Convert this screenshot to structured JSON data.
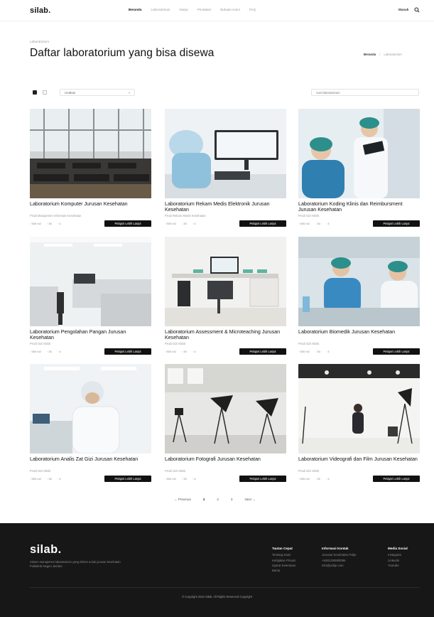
{
  "header": {
    "logo": "silab.",
    "nav": [
      "Beranda",
      "Laboratorium",
      "Sarpa",
      "Peralatan",
      "Bukaan Kami",
      "FAQ"
    ],
    "active_nav": 0,
    "lang": "Masuk"
  },
  "page": {
    "eyebrow": "Laboratorium",
    "title": "Daftar laboratorium yang bisa disewa",
    "breadcrumb": {
      "home": "Beranda",
      "sep": "/",
      "current": "Laboratorium"
    }
  },
  "toolbar": {
    "sort_label": "Urutkan",
    "search_placeholder": "Cari laboratorium"
  },
  "cards": [
    {
      "title": "Laboratorium Komputer Jurusan Kesehatan",
      "subtitle": "Prodi Manajemen Informasi Kesehatan",
      "meta": [
        "500 m2",
        "30",
        "4"
      ],
      "button": "Pelajari Lebih Lanjut"
    },
    {
      "title": "Laboratorium Rekam Medis Elektronik Jurusan Kesehatan",
      "subtitle": "Prodi Rekam Medis Kesehatan",
      "meta": [
        "500 m2",
        "30",
        "4"
      ],
      "button": "Pelajari Lebih Lanjut"
    },
    {
      "title": "Laboratorium Koding Klinis dan Reimbursment Jurusan Kesehatan",
      "subtitle": "Prodi Gizi Klinik",
      "meta": [
        "500 m2",
        "30",
        "4"
      ],
      "button": "Pelajari Lebih Lanjut"
    },
    {
      "title": "Laboratorium Pengolahan Pangan Jurusan Kesehatan",
      "subtitle": "Prodi Gizi Klinik",
      "meta": [
        "500 m2",
        "30",
        "4"
      ],
      "button": "Pelajari Lebih Lanjut"
    },
    {
      "title": "Laboratorium Assessment & Microteaching Jurusan Kesehatan",
      "subtitle": "Prodi Gizi Klinik",
      "meta": [
        "500 m2",
        "30",
        "4"
      ],
      "button": "Pelajari Lebih Lanjut"
    },
    {
      "title": "Laboratorium Biomedik Jurusan Kesehatan",
      "subtitle": "Prodi Gizi Klinik",
      "meta": [
        "500 m2",
        "30",
        "4"
      ],
      "button": "Pelajari Lebih Lanjut"
    },
    {
      "title": "Laboratorium Analis Zat Gizi Jurusan Kesehatan",
      "subtitle": "Prodi Gizi Klinik",
      "meta": [
        "500 m2",
        "30",
        "4"
      ],
      "button": "Pelajari Lebih Lanjut"
    },
    {
      "title": "Laboratorium Fotografi Jurusan Kesehatan",
      "subtitle": "Prodi Gizi Klinik",
      "meta": [
        "500 m2",
        "30",
        "4"
      ],
      "button": "Pelajari Lebih Lanjut"
    },
    {
      "title": "Laboratorium Videografi dan Film Jurusan Kesehatan",
      "subtitle": "Prodi Gizi Klinik",
      "meta": [
        "500 m2",
        "30",
        "4"
      ],
      "button": "Pelajari Lebih Lanjut"
    }
  ],
  "pagination": {
    "prev": "← Previous",
    "pages": [
      "1",
      "2",
      "3"
    ],
    "next": "Next →"
  },
  "footer": {
    "logo": "silab.",
    "description": "Sistem manajemen laboratorium yang efisien untuk jurusan kesehatan Politeknik Negeri Jember.",
    "cols": [
      {
        "heading": "Tautan Cepat",
        "links": [
          "Tentang Kami",
          "Kebijakan Privasi",
          "Syarat Ketentuan",
          "Bantu"
        ]
      },
      {
        "heading": "Informasi Kontak",
        "links": [
          "Jurusan Kesehatan Polije",
          "+6281250800096",
          "info@polije.com"
        ]
      },
      {
        "heading": "Media Sosial",
        "links": [
          "Instagram",
          "LinkedIn",
          "Youtube"
        ]
      }
    ],
    "copyright": "© Copyright 2024 Silab. All Rights Reserved Copyright"
  },
  "colors": {
    "accent": "#111111",
    "footer_bg": "#171717"
  }
}
